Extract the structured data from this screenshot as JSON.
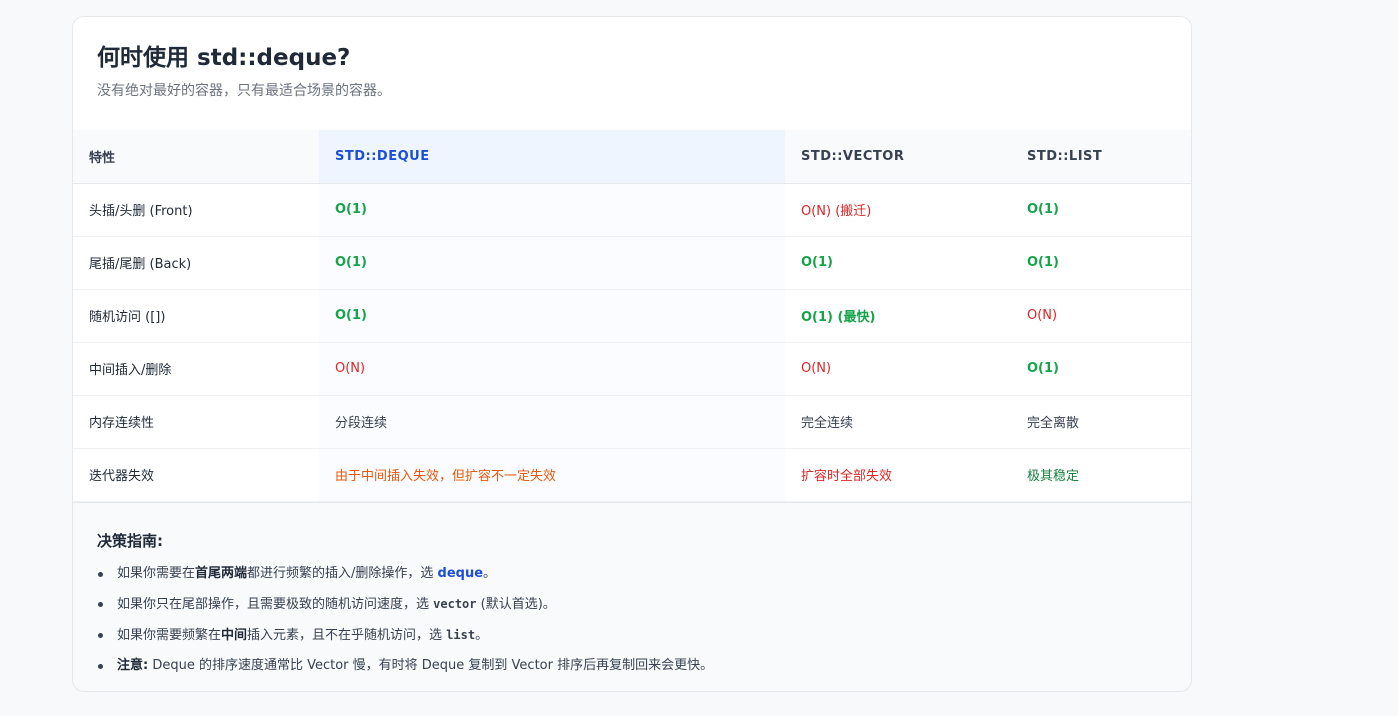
{
  "header": {
    "title": "何时使用 std::deque?",
    "subtitle": "没有绝对最好的容器，只有最适合场景的容器。"
  },
  "table": {
    "columns": [
      "特性",
      "STD::DEQUE",
      "STD::VECTOR",
      "STD::LIST"
    ],
    "rows": [
      {
        "feature": "头插/头删 (Front)",
        "deque": "O(1)",
        "vector": "O(N) (搬迁)",
        "list": "O(1)"
      },
      {
        "feature": "尾插/尾删 (Back)",
        "deque": "O(1)",
        "vector": "O(1)",
        "list": "O(1)"
      },
      {
        "feature": "随机访问 ([])",
        "deque": "O(1)",
        "vector": "O(1) (最快)",
        "list": "O(N)"
      },
      {
        "feature": "中间插入/删除",
        "deque": "O(N)",
        "vector": "O(N)",
        "list": "O(1)"
      },
      {
        "feature": "内存连续性",
        "deque": "分段连续",
        "vector": "完全连续",
        "list": "完全离散"
      },
      {
        "feature": "迭代器失效",
        "deque": "由于中间插入失效，但扩容不一定失效",
        "vector": "扩容时全部失效",
        "list": "极其稳定"
      }
    ]
  },
  "guide": {
    "title": "决策指南:",
    "items": [
      {
        "pre": "如果你需要在",
        "strong": "首尾两端",
        "mid": "都进行频繁的插入/删除操作，选 ",
        "code": "deque",
        "post": "。"
      },
      {
        "pre": "如果你只在尾部操作，且需要极致的随机访问速度，选 ",
        "code": "vector",
        "post": " (默认首选)。"
      },
      {
        "pre": "如果你需要频繁在",
        "strong": "中间",
        "mid": "插入元素，且不在乎随机访问，选 ",
        "code": "list",
        "post": "。"
      },
      {
        "strong": "注意:",
        "post": " Deque 的排序速度通常比 Vector 慢，有时将 Deque 复制到 Vector 排序后再复制回来会更快。"
      }
    ]
  },
  "colors": {
    "good": "#16a34a",
    "bad": "#dc2626",
    "warn": "#ea580c",
    "highlight": "#1d4ed8"
  }
}
